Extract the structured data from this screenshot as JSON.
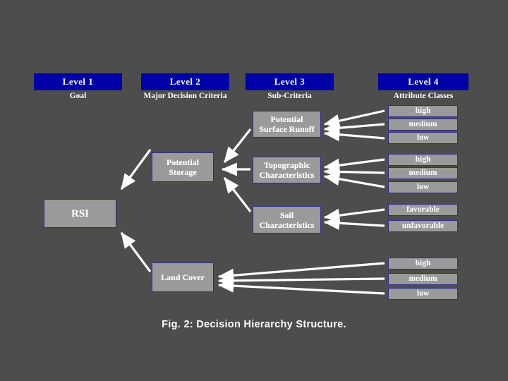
{
  "figure": {
    "caption": "Fig. 2:  Decision Hierarchy Structure.",
    "background_color": "#4d4d4d",
    "header_color": "#0000a8",
    "node_fill_color": "#9a9a9a",
    "node_border_color": "#2f2f87",
    "arrow_color": "#ffffff",
    "text_color": "#ffffff"
  },
  "levels": [
    {
      "title": "Level 1",
      "subtitle": "Goal"
    },
    {
      "title": "Level 2",
      "subtitle": "Major Decision Criteria"
    },
    {
      "title": "Level 3",
      "subtitle": "Sub-Criteria"
    },
    {
      "title": "Level 4",
      "subtitle": "Attribute Classes"
    }
  ],
  "nodes": {
    "goal": {
      "label": "RSI"
    },
    "criteria": [
      {
        "label_line1": "Potential",
        "label_line2": "Storage"
      },
      {
        "label_line1": "Land Cover",
        "label_line2": ""
      }
    ],
    "subcriteria": [
      {
        "label_line1": "Potential",
        "label_line2": "Surface Runoff"
      },
      {
        "label_line1": "Topographic",
        "label_line2": "Characteristics"
      },
      {
        "label_line1": "Soil",
        "label_line2": "Characteristics"
      }
    ]
  },
  "attribute_groups": [
    {
      "for": "Potential Surface Runoff",
      "classes": [
        "high",
        "medium",
        "low"
      ]
    },
    {
      "for": "Topographic Characteristics",
      "classes": [
        "high",
        "medium",
        "low"
      ]
    },
    {
      "for": "Soil Characteristics",
      "classes": [
        "favorable",
        "unfavorable"
      ]
    },
    {
      "for": "Land Cover",
      "classes": [
        "high",
        "medium",
        "low"
      ]
    }
  ]
}
